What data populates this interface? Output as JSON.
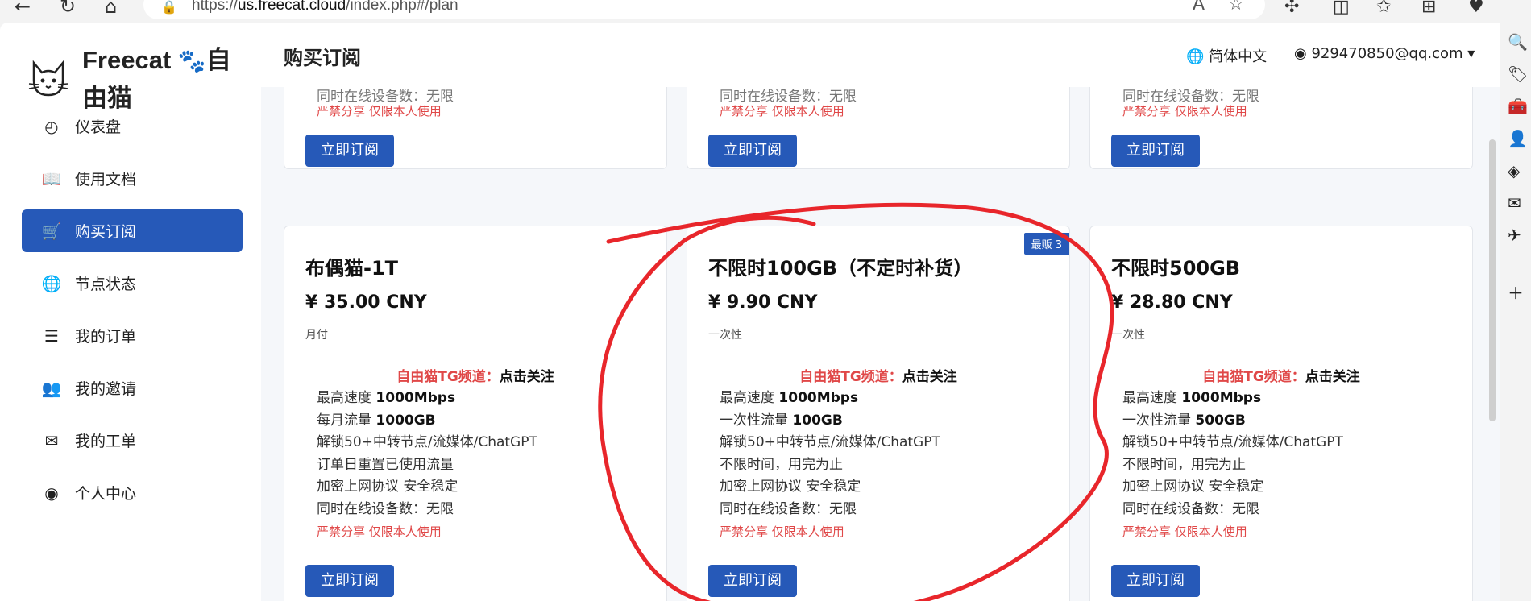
{
  "browser": {
    "url_prefix": "https://",
    "url_domain": "us.freecat.cloud",
    "url_path": "/index.php#/plan"
  },
  "sidebar": {
    "brand_line1": "Freecat",
    "brand_line2": "由猫",
    "brand_tail": "自",
    "items": [
      {
        "label": "仪表盘",
        "icon": "dashboard-icon"
      },
      {
        "label": "使用文档",
        "icon": "book-icon"
      },
      {
        "label": "购买订阅",
        "icon": "cart-icon"
      },
      {
        "label": "节点状态",
        "icon": "globe-icon"
      },
      {
        "label": "我的订单",
        "icon": "order-list-icon"
      },
      {
        "label": "我的邀请",
        "icon": "users-icon"
      },
      {
        "label": "我的工单",
        "icon": "ticket-icon"
      },
      {
        "label": "个人中心",
        "icon": "user-circle-icon"
      }
    ]
  },
  "header": {
    "title": "购买订阅",
    "language": "简体中文",
    "user_email": "929470850@qq.com"
  },
  "top_cards": {
    "partial_line": "同时在线设备数：无限",
    "warning": "严禁分享 仅限本人使用",
    "button": "立即订阅"
  },
  "plans": [
    {
      "title": "布偶猫-1T",
      "price": "¥ 35.00 CNY",
      "period": "月付",
      "tg_label": "自由猫TG频道：",
      "tg_action": "点击关注",
      "features": [
        {
          "pre": "最高速度 ",
          "bold": "1000Mbps"
        },
        {
          "pre": "每月流量 ",
          "bold": "1000GB"
        },
        {
          "pre": "解锁50+中转节点/流媒体/ChatGPT",
          "bold": ""
        },
        {
          "pre": "订单日重置已使用流量",
          "bold": ""
        },
        {
          "pre": "加密上网协议 安全稳定",
          "bold": ""
        },
        {
          "pre": "同时在线设备数：无限",
          "bold": ""
        }
      ],
      "warning": "严禁分享 仅限本人使用",
      "button": "立即订阅"
    },
    {
      "title": "不限时100GB（不定时补货）",
      "price": "¥ 9.90 CNY",
      "period": "一次性",
      "badge": "最贩 3",
      "tg_label": "自由猫TG频道：",
      "tg_action": "点击关注",
      "features": [
        {
          "pre": "最高速度 ",
          "bold": "1000Mbps"
        },
        {
          "pre": "一次性流量 ",
          "bold": "100GB"
        },
        {
          "pre": "解锁50+中转节点/流媒体/ChatGPT",
          "bold": ""
        },
        {
          "pre": "不限时间，用完为止",
          "bold": ""
        },
        {
          "pre": "加密上网协议 安全稳定",
          "bold": ""
        },
        {
          "pre": "同时在线设备数：无限",
          "bold": ""
        }
      ],
      "warning": "严禁分享 仅限本人使用",
      "button": "立即订阅"
    },
    {
      "title": "不限时500GB",
      "price": "¥ 28.80 CNY",
      "period": "一次性",
      "tg_label": "自由猫TG频道：",
      "tg_action": "点击关注",
      "features": [
        {
          "pre": "最高速度 ",
          "bold": "1000Mbps"
        },
        {
          "pre": "一次性流量 ",
          "bold": "500GB"
        },
        {
          "pre": "解锁50+中转节点/流媒体/ChatGPT",
          "bold": ""
        },
        {
          "pre": "不限时间，用完为止",
          "bold": ""
        },
        {
          "pre": "加密上网协议 安全稳定",
          "bold": ""
        },
        {
          "pre": "同时在线设备数：无限",
          "bold": ""
        }
      ],
      "warning": "严禁分享 仅限本人使用",
      "button": "立即订阅"
    }
  ],
  "colors": {
    "primary": "#2659b8",
    "warning": "#e04848",
    "annotation": "#e8262b"
  }
}
